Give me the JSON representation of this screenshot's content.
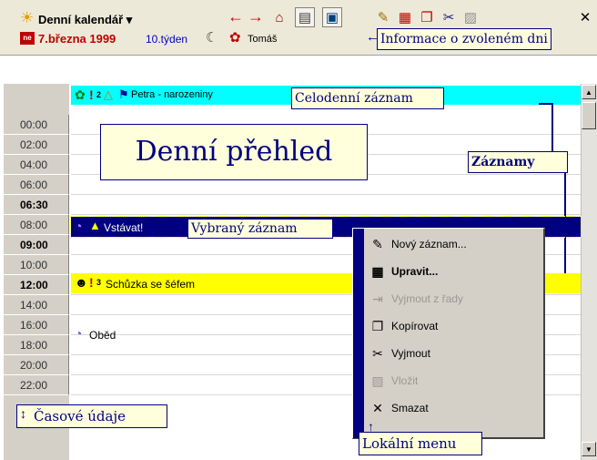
{
  "toolbar": {
    "title": "Denní kalendář ▾",
    "date": "7.března 1999",
    "week": "10.týden",
    "user": "Tomáš"
  },
  "callouts": {
    "info": "Informace o zvoleném dni",
    "allday": "Celodenní záznam",
    "overview": "Denní přehled",
    "records": "Záznamy",
    "selected": "Vybraný záznam",
    "time": "Časové údaje",
    "local_menu": "Lokální menu"
  },
  "allday": {
    "label": "Petra - narozeniny",
    "badge": "2"
  },
  "times": [
    {
      "label": "00:00",
      "bold": false
    },
    {
      "label": "02:00",
      "bold": false
    },
    {
      "label": "04:00",
      "bold": false
    },
    {
      "label": "06:00",
      "bold": false
    },
    {
      "label": "06:30",
      "bold": true
    },
    {
      "label": "08:00",
      "bold": false
    },
    {
      "label": "09:00",
      "bold": true
    },
    {
      "label": "10:00",
      "bold": false
    },
    {
      "label": "12:00",
      "bold": true
    },
    {
      "label": "14:00",
      "bold": false
    },
    {
      "label": "16:00",
      "bold": false
    },
    {
      "label": "18:00",
      "bold": false
    },
    {
      "label": "20:00",
      "bold": false
    },
    {
      "label": "22:00",
      "bold": false
    }
  ],
  "entries": {
    "wake": "Vstávat!",
    "meeting": "Schůzka se šéfem",
    "meeting_badge": "3",
    "lunch": "Oběd"
  },
  "context_menu": {
    "items": [
      {
        "label": "Nový záznam...",
        "icon": "new-record-icon",
        "enabled": true,
        "bold": false
      },
      {
        "label": "Upravit...",
        "icon": "edit-icon",
        "enabled": true,
        "bold": true
      },
      {
        "label": "Vyjmout z řady",
        "icon": "remove-series-icon",
        "enabled": false,
        "bold": false
      },
      {
        "label": "Kopírovat",
        "icon": "copy-icon",
        "enabled": true,
        "bold": false
      },
      {
        "label": "Vyjmout",
        "icon": "cut-icon",
        "enabled": true,
        "bold": false
      },
      {
        "label": "Vložit",
        "icon": "paste-icon",
        "enabled": false,
        "bold": false
      },
      {
        "label": "Smazat",
        "icon": "delete-icon",
        "enabled": true,
        "bold": false
      }
    ]
  },
  "colors": {
    "allday_bg": "#00ffff",
    "selected_bg": "#000080",
    "meeting_bg": "#ffff00",
    "callout_border": "#000080"
  }
}
